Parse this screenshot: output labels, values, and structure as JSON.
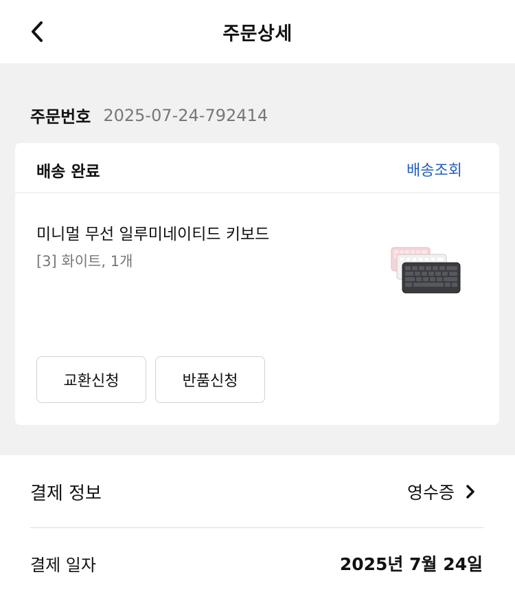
{
  "header": {
    "title": "주문상세",
    "back_icon": "chevron-left-icon"
  },
  "order": {
    "number_label": "주문번호",
    "number_value": "2025-07-24-792414"
  },
  "shipment": {
    "status": "배송 완료",
    "track_label": "배송조회",
    "track_color": "#1f5fbf"
  },
  "product": {
    "name": "미니멀 무선 일루미네이티드 키보드",
    "option": "[3] 화이트, 1개",
    "thumbnail_icon": "keyboard-product-image"
  },
  "actions": {
    "exchange_label": "교환신청",
    "return_label": "반품신청"
  },
  "payment": {
    "title": "결제 정보",
    "receipt_label": "영수증",
    "receipt_icon": "chevron-right-icon",
    "date_label": "결제 일자",
    "date_value": "2025년 7월 24일"
  }
}
